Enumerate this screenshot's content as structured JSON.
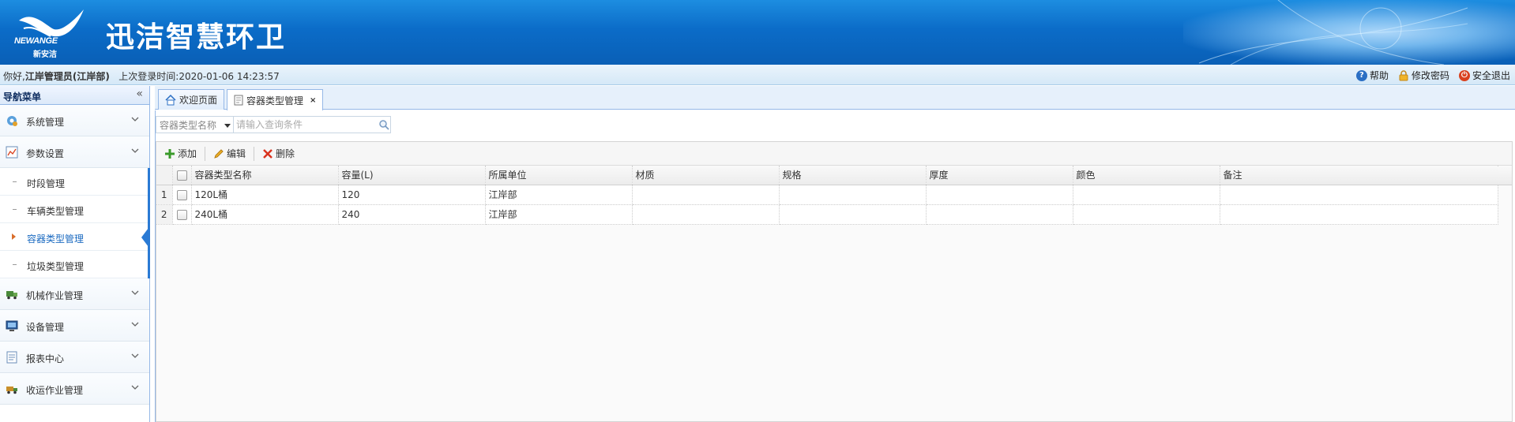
{
  "header": {
    "logo_en": "NEWANGE",
    "logo_cn": "新安洁",
    "app_title": "迅洁智慧环卫"
  },
  "statusbar": {
    "greeting_prefix": "你好,",
    "user": "江岸管理员(江岸部)",
    "last_login_label": "上次登录时间:",
    "last_login_time": "2020-01-06 14:23:57",
    "help": "帮助",
    "change_password": "修改密码",
    "logout": "安全退出"
  },
  "sidebar": {
    "title": "导航菜单",
    "collapse_glyph": "«",
    "groups": [
      {
        "label": "系统管理",
        "icon": "gear-icon"
      },
      {
        "label": "参数设置",
        "icon": "chart-icon",
        "expanded": true,
        "items": [
          {
            "label": "时段管理"
          },
          {
            "label": "车辆类型管理"
          },
          {
            "label": "容器类型管理",
            "selected": true
          },
          {
            "label": "垃圾类型管理"
          }
        ]
      },
      {
        "label": "机械作业管理",
        "icon": "truck-icon"
      },
      {
        "label": "设备管理",
        "icon": "monitor-icon"
      },
      {
        "label": "报表中心",
        "icon": "report-icon"
      },
      {
        "label": "收运作业管理",
        "icon": "delivery-truck-icon"
      }
    ]
  },
  "tabs": [
    {
      "label": "欢迎页面",
      "icon": "home-icon"
    },
    {
      "label": "容器类型管理",
      "icon": "page-icon",
      "active": true,
      "close": "×"
    }
  ],
  "search": {
    "field_label": "容器类型名称",
    "placeholder": "请输入查询条件"
  },
  "toolbar": {
    "add": "添加",
    "edit": "编辑",
    "delete": "删除"
  },
  "grid": {
    "columns": [
      "容器类型名称",
      "容量(L)",
      "所属单位",
      "材质",
      "规格",
      "厚度",
      "颜色",
      "备注"
    ],
    "rows": [
      {
        "num": "1",
        "name": "120L桶",
        "capacity": "120",
        "unit": "江岸部",
        "material": "",
        "spec": "",
        "thickness": "",
        "color": "",
        "remark": ""
      },
      {
        "num": "2",
        "name": "240L桶",
        "capacity": "240",
        "unit": "江岸部",
        "material": "",
        "spec": "",
        "thickness": "",
        "color": "",
        "remark": ""
      }
    ]
  },
  "colors": {
    "banner": "#0b6cc8",
    "accent": "#2a7ad4",
    "selected_text": "#1b6ac0"
  }
}
